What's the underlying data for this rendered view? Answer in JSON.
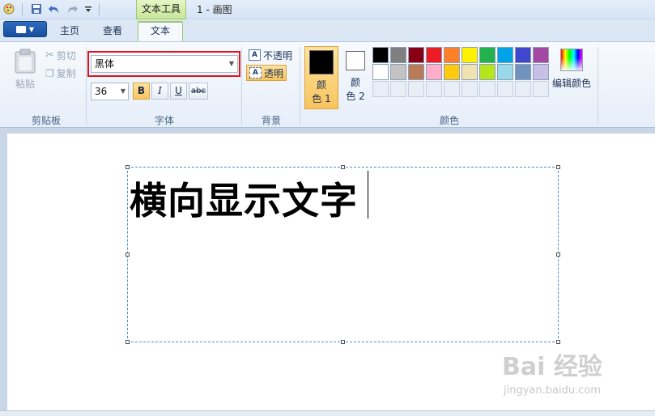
{
  "titlebar": {
    "context_tab": "文本工具",
    "window_title": "1 - 画图"
  },
  "tabs": [
    {
      "label": "主页"
    },
    {
      "label": "查看"
    },
    {
      "label": "文本",
      "active": true
    }
  ],
  "clipboard": {
    "paste": "粘贴",
    "cut": "剪切",
    "copy": "复制",
    "group": "剪贴板"
  },
  "font": {
    "family": "黑体",
    "size": "36",
    "bold": "B",
    "italic": "I",
    "underline": "U",
    "strike": "abc",
    "group": "字体"
  },
  "background": {
    "opaque": "不透明",
    "transparent": "透明",
    "group": "背景"
  },
  "colors": {
    "color1_label": "颜\n色 1",
    "color1_a": "颜",
    "color1_b": "色 1",
    "color2_a": "颜",
    "color2_b": "色 2",
    "color1": "#000000",
    "color2": "#ffffff",
    "edit": "编辑颜色",
    "group": "颜色",
    "palette_row1": [
      "#000000",
      "#7f7f7f",
      "#880015",
      "#ed1c24",
      "#ff7f27",
      "#fff200",
      "#22b14c",
      "#00a2e8",
      "#3f48cc",
      "#a349a4"
    ],
    "palette_row2": [
      "#ffffff",
      "#c3c3c3",
      "#b97a57",
      "#ffaec9",
      "#ffc90e",
      "#efe4b0",
      "#b5e61d",
      "#99d9ea",
      "#7092be",
      "#c8bfe7"
    ]
  },
  "canvas": {
    "text": "横向显示文字"
  },
  "watermark": {
    "brand": "Bai 经验",
    "url": "jingyan.baidu.com"
  }
}
